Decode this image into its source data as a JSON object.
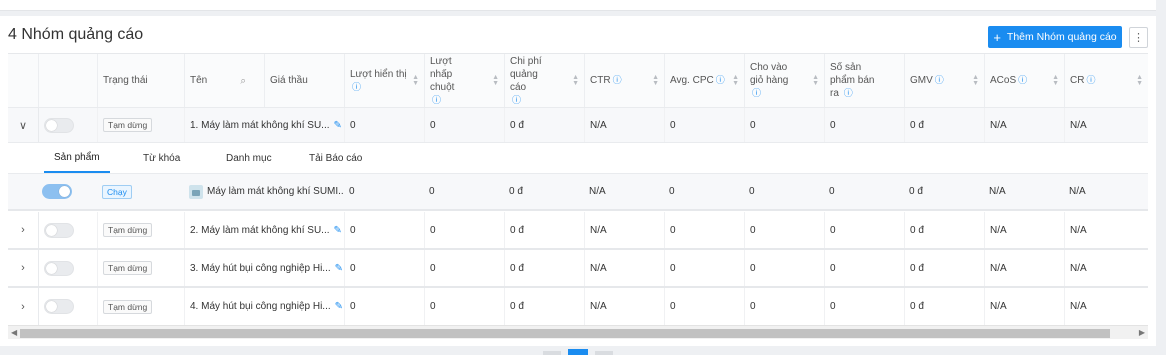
{
  "title": "4 Nhóm quảng cáo",
  "add_button": "Thêm Nhóm quảng cáo",
  "more_button": "⋮",
  "headers": {
    "status": "Trạng thái",
    "name": "Tên",
    "bid": "Giá thầu",
    "impressions": "Lượt hiển thị",
    "clicks": "Lượt nhấp chuột",
    "cost": "Chi phí quảng cáo",
    "ctr": "CTR",
    "avg_cpc": "Avg. CPC",
    "add_to_cart": "Cho vào giỏ hàng",
    "products_sold": "Số sản phẩm bán ra",
    "gmv": "GMV",
    "acos": "ACoS",
    "cr": "CR"
  },
  "tabs": [
    "Sản phẩm",
    "Từ khóa",
    "Danh mục",
    "Tải Báo cáo"
  ],
  "rows": [
    {
      "status": "Tạm dừng",
      "name": "1.  Máy làm mát không khí SU...",
      "impressions": "0",
      "clicks": "0",
      "cost": "0 đ",
      "ctr": "N/A",
      "avg_cpc": "0",
      "add_to_cart": "0",
      "products_sold": "0",
      "gmv": "0 đ",
      "acos": "N/A",
      "cr": "N/A"
    },
    {
      "status": "Tạm dừng",
      "name": "2.  Máy làm mát không khí SU...",
      "impressions": "0",
      "clicks": "0",
      "cost": "0 đ",
      "ctr": "N/A",
      "avg_cpc": "0",
      "add_to_cart": "0",
      "products_sold": "0",
      "gmv": "0 đ",
      "acos": "N/A",
      "cr": "N/A"
    },
    {
      "status": "Tạm dừng",
      "name": "3.  Máy hút bụi công nghiệp Hi...",
      "impressions": "0",
      "clicks": "0",
      "cost": "0 đ",
      "ctr": "N/A",
      "avg_cpc": "0",
      "add_to_cart": "0",
      "products_sold": "0",
      "gmv": "0 đ",
      "acos": "N/A",
      "cr": "N/A"
    },
    {
      "status": "Tạm dừng",
      "name": "4.  Máy hút bụi công nghiệp Hi...",
      "impressions": "0",
      "clicks": "0",
      "cost": "0 đ",
      "ctr": "N/A",
      "avg_cpc": "0",
      "add_to_cart": "0",
      "products_sold": "0",
      "gmv": "0 đ",
      "acos": "N/A",
      "cr": "N/A"
    }
  ],
  "sub_row": {
    "status": "Chạy",
    "name": "Máy làm mát không khí SUMI...",
    "impressions": "0",
    "clicks": "0",
    "cost": "0 đ",
    "ctr": "N/A",
    "avg_cpc": "0",
    "add_to_cart": "0",
    "products_sold": "0",
    "gmv": "0 đ",
    "acos": "N/A",
    "cr": "N/A"
  },
  "accent_color": "#1a8cf0"
}
